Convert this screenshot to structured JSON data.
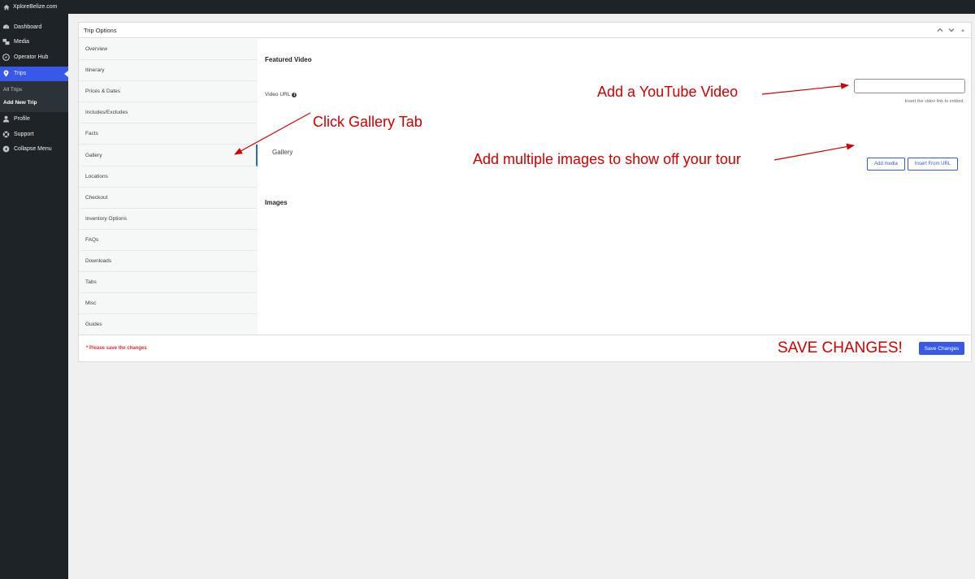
{
  "admin_bar": {
    "site_name": "XploreBelize.com"
  },
  "sidebar": {
    "items": [
      {
        "label": "Dashboard",
        "icon": "dashboard-icon"
      },
      {
        "label": "Media",
        "icon": "media-icon"
      },
      {
        "label": "Operator Hub",
        "icon": "operator-hub-icon"
      },
      {
        "label": "Trips",
        "icon": "location-pin-icon",
        "active": true
      },
      {
        "label": "Profile",
        "icon": "profile-icon"
      },
      {
        "label": "Support",
        "icon": "support-icon"
      },
      {
        "label": "Collapse Menu",
        "icon": "collapse-icon"
      }
    ],
    "submenu": [
      {
        "label": "All Trips"
      },
      {
        "label": "Add New Trip",
        "current": true
      }
    ]
  },
  "panel": {
    "title": "Trip Options",
    "tabs": [
      "Overview",
      "Itinerary",
      "Prices & Dates",
      "Includes/Excludes",
      "Facts",
      "Gallery",
      "Locations",
      "Checkout",
      "Inventory Options",
      "FAQs",
      "Downloads",
      "Tabs",
      "Misc",
      "Guides"
    ],
    "content": {
      "featured_video_title": "Featured Video",
      "video_url_label": "Video URL",
      "video_url_value": "",
      "video_help": "Insert the video link to embed.",
      "gallery_title": "Gallery",
      "add_media_label": "Add media",
      "insert_url_label": "Insert From URL",
      "images_title": "Images"
    },
    "footer": {
      "note": "* Please save the changes",
      "save_label": "Save Changes"
    }
  },
  "annotations": {
    "youtube": "Add a YouTube Video",
    "gallery_tab": "Click Gallery Tab",
    "images": "Add multiple images to show off your tour",
    "save": "SAVE CHANGES!"
  },
  "colors": {
    "accent": "#3858e9",
    "annotation": "#cc0000",
    "sidebar_bg": "#1d2327",
    "note_red": "#d63638"
  }
}
